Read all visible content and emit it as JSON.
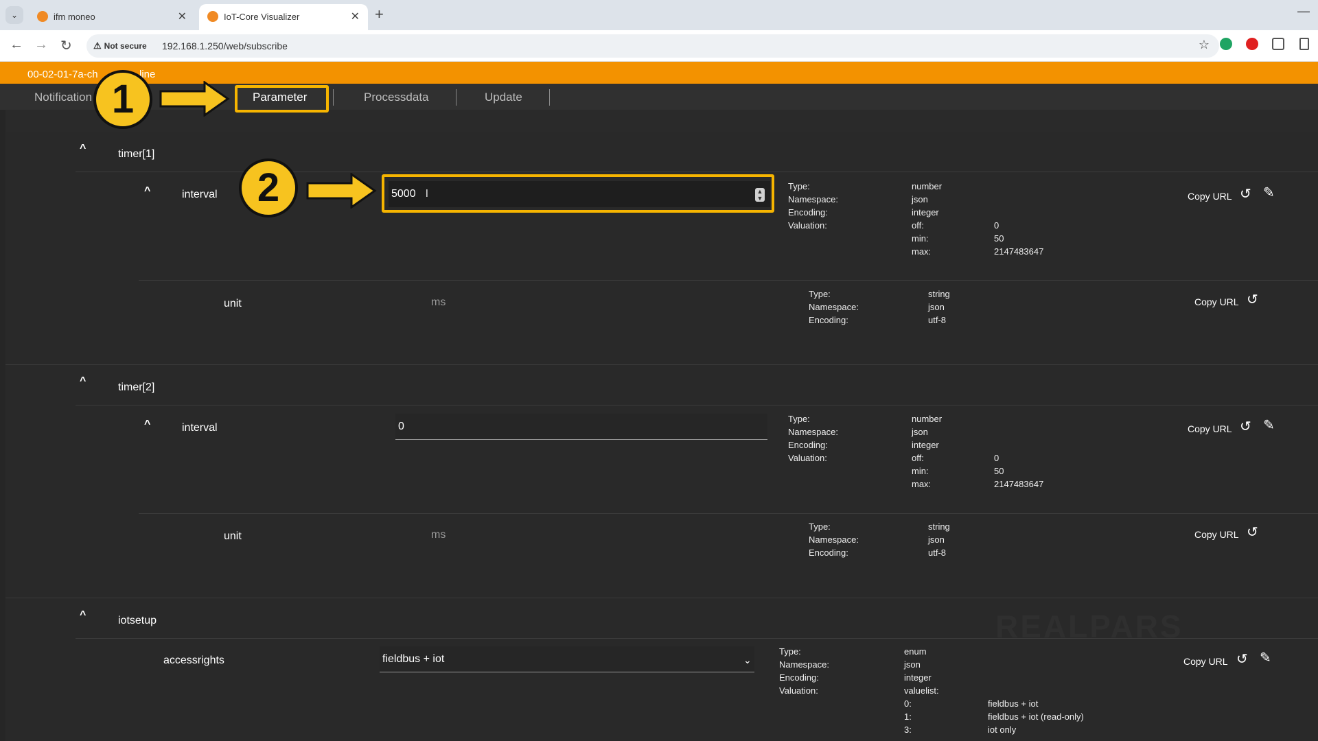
{
  "browser": {
    "tabs": [
      {
        "title": "ifm moneo",
        "active": false
      },
      {
        "title": "IoT-Core Visualizer",
        "active": true
      }
    ],
    "security_label": "Not secure",
    "url": "192.168.1.250/web/subscribe"
  },
  "app": {
    "device_name": "00-02-01-7a-ch",
    "device_name_tail": "line",
    "nav": [
      {
        "label": "Notification"
      },
      {
        "label": "Parameter",
        "active": true
      },
      {
        "label": "Processdata"
      },
      {
        "label": "Update"
      }
    ],
    "caret": "^",
    "copy_url": "Copy URL",
    "sections": [
      {
        "name": "timer[1]",
        "rows": [
          {
            "label": "interval",
            "value": "5000",
            "meta_keys": [
              "Type:",
              "Namespace:",
              "Encoding:",
              "Valuation:"
            ],
            "meta_values": [
              "number",
              "json",
              "integer",
              "off:",
              "min:",
              "max:"
            ],
            "meta_values2": [
              "0",
              "50",
              "2147483647"
            ]
          },
          {
            "label": "unit",
            "value": "ms",
            "meta_keys": [
              "Type:",
              "Namespace:",
              "Encoding:"
            ],
            "meta_values": [
              "string",
              "json",
              "utf-8"
            ]
          }
        ]
      },
      {
        "name": "timer[2]",
        "rows": [
          {
            "label": "interval",
            "value": "0",
            "meta_keys": [
              "Type:",
              "Namespace:",
              "Encoding:",
              "Valuation:"
            ],
            "meta_values": [
              "number",
              "json",
              "integer",
              "off:",
              "min:",
              "max:"
            ],
            "meta_values2": [
              "0",
              "50",
              "2147483647"
            ]
          },
          {
            "label": "unit",
            "value": "ms",
            "meta_keys": [
              "Type:",
              "Namespace:",
              "Encoding:"
            ],
            "meta_values": [
              "string",
              "json",
              "utf-8"
            ]
          }
        ]
      },
      {
        "name": "iotsetup",
        "rows": [
          {
            "label": "accessrights",
            "value": "fieldbus + iot",
            "meta_keys": [
              "Type:",
              "Namespace:",
              "Encoding:",
              "Valuation:"
            ],
            "meta_values": [
              "enum",
              "json",
              "integer",
              "valuelist:",
              "0:",
              "1:",
              "3:"
            ],
            "meta_values2": [
              "fieldbus + iot",
              "fieldbus + iot (read-only)",
              "iot only"
            ]
          }
        ]
      }
    ]
  },
  "annotations": {
    "step1": "1",
    "step2": "2",
    "accent_color": "#f7b500"
  },
  "watermark": "REALPARS",
  "colors": {
    "header_orange": "#f39200",
    "background": "#262626"
  }
}
